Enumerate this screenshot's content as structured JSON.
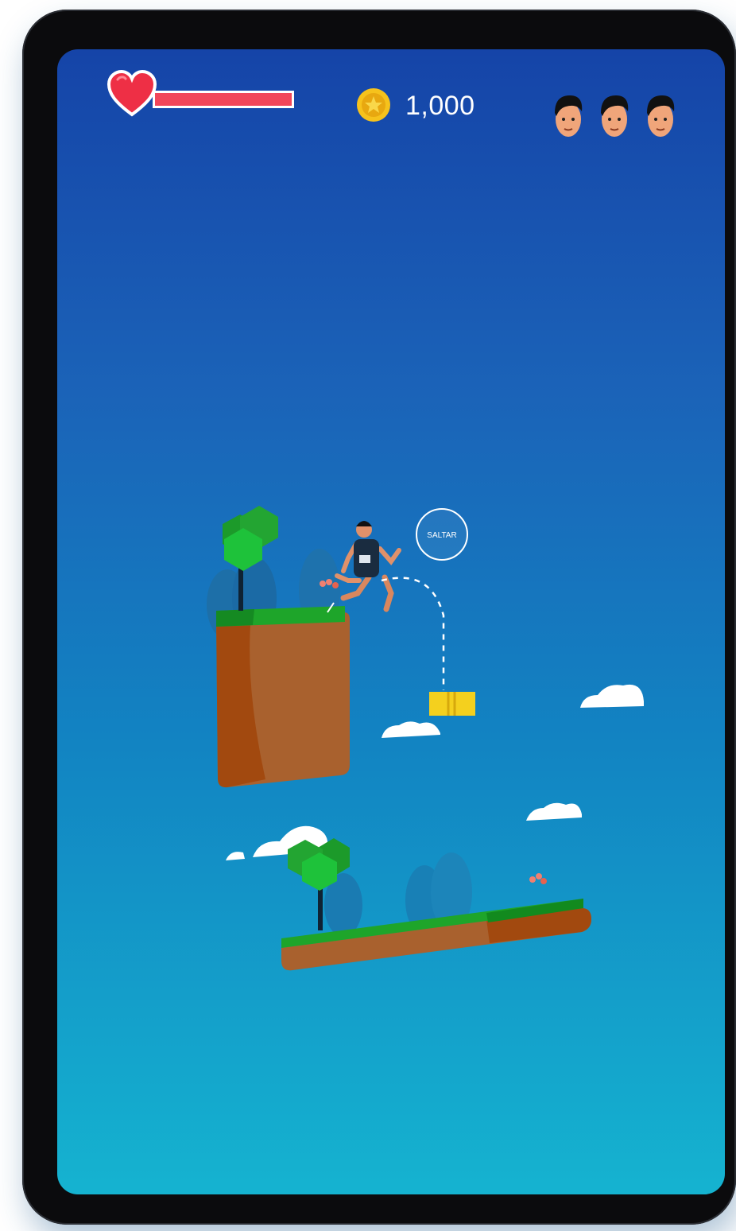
{
  "hud": {
    "coins": "1,000",
    "health_fraction": 1.0,
    "lives_remaining": 3
  },
  "jump_button": {
    "label": "SALTAR"
  },
  "colors": {
    "sky_top": "#1544a8",
    "sky_bottom": "#15b3d0",
    "health": "#f2465a",
    "coin": "#f6c21c",
    "grass": "#1fa52a",
    "dirt": "#a9612e",
    "block": "#f4d01e"
  },
  "icons": {
    "heart": "heart-icon",
    "coin": "coin-icon",
    "life": "player-face-icon"
  }
}
